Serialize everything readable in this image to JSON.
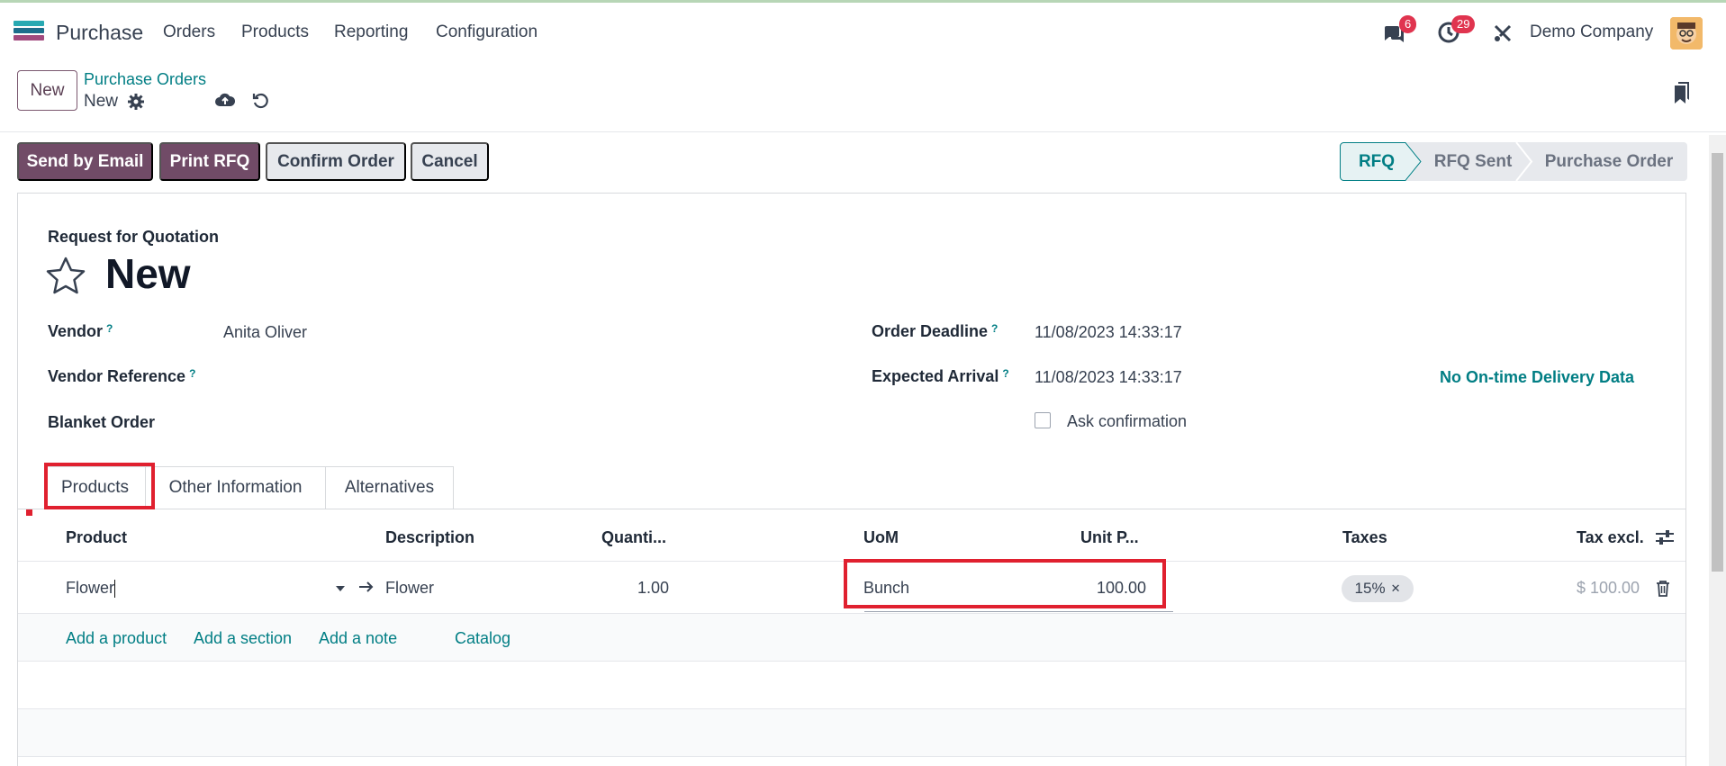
{
  "navbar": {
    "app_name": "Purchase",
    "menu": [
      "Orders",
      "Products",
      "Reporting",
      "Configuration"
    ],
    "messages_count": "6",
    "activities_count": "29",
    "company": "Demo Company"
  },
  "control": {
    "new_label": "New",
    "breadcrumb": "Purchase Orders",
    "record_name": "New"
  },
  "actions": {
    "send_email": "Send by Email",
    "print_rfq": "Print RFQ",
    "confirm": "Confirm Order",
    "cancel": "Cancel"
  },
  "status": {
    "stages": [
      "RFQ",
      "RFQ Sent",
      "Purchase Order"
    ],
    "current": "RFQ"
  },
  "form": {
    "subtitle": "Request for Quotation",
    "title": "New",
    "vendor_label": "Vendor",
    "vendor_value": "Anita Oliver",
    "vendor_ref_label": "Vendor Reference",
    "blanket_label": "Blanket Order",
    "deadline_label": "Order Deadline",
    "deadline_value": "11/08/2023 14:33:17",
    "arrival_label": "Expected Arrival",
    "arrival_value": "11/08/2023 14:33:17",
    "ontime_link": "No On-time Delivery Data",
    "ask_confirmation": "Ask confirmation",
    "help_mark": "?"
  },
  "tabs": [
    "Products",
    "Other Information",
    "Alternatives"
  ],
  "table": {
    "headers": {
      "product": "Product",
      "description": "Description",
      "quantity": "Quanti...",
      "uom": "UoM",
      "unit_price": "Unit P...",
      "taxes": "Taxes",
      "tax_excl": "Tax excl."
    },
    "row": {
      "product": "Flower",
      "description": "Flower",
      "quantity": "1.00",
      "uom": "Bunch",
      "unit_price": "100.00",
      "tax": "15%",
      "subtotal": "$ 100.00"
    },
    "add_links": [
      "Add a product",
      "Add a section",
      "Add a note",
      "Catalog"
    ]
  },
  "colors": {
    "primary": "#714b67",
    "link": "#017e84",
    "highlight": "#e0202f"
  }
}
